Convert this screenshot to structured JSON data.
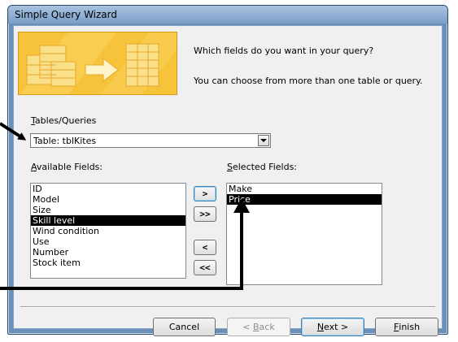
{
  "window": {
    "title": "Simple Query Wizard",
    "prompt_fields": "Which fields do you want in your query?",
    "prompt_choose": "You can choose from more than one table or query."
  },
  "tables": {
    "label_accel": "T",
    "label_rest": "ables/Queries",
    "selected": "Table: tblKites"
  },
  "available": {
    "label_accel": "A",
    "label_rest": "vailable Fields:",
    "items": [
      "ID",
      "Model",
      "Size",
      "Skill level",
      "Wind condition",
      "Use",
      "Number",
      "Stock item"
    ],
    "selected_index": 3
  },
  "selected_fields": {
    "label_accel": "S",
    "label_rest": "elected Fields:",
    "items": [
      "Make",
      "Price"
    ],
    "selected_index": 1
  },
  "move_buttons": {
    "add_one": ">",
    "add_all": ">>",
    "remove_one": "<",
    "remove_all": "<<"
  },
  "buttons": {
    "cancel": "Cancel",
    "back_symbol": "< ",
    "back_accel": "B",
    "back_rest": "ack",
    "next_accel": "N",
    "next_rest": "ext >",
    "finish_accel": "F",
    "finish_rest": "inish"
  },
  "colors": {
    "selection": "#000000",
    "banner": "#f7c33b"
  }
}
